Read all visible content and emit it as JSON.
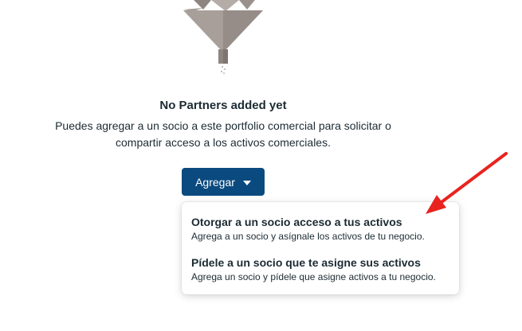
{
  "empty_state": {
    "title": "No Partners added yet",
    "description": "Puedes agregar a un socio a este portfolio comercial para solicitar o compartir acceso a los activos comerciales."
  },
  "add_button": {
    "label": "Agregar",
    "icon": "caret-down-icon",
    "color": "#0a4a7f"
  },
  "menu": {
    "items": [
      {
        "title": "Otorgar a un socio acceso a tus activos",
        "description": "Agrega a un socio y asígnale los activos de tu negocio."
      },
      {
        "title": "Pídele a un socio que te asigne sus activos",
        "description": "Agrega un socio y pídele que asigne activos a tu negocio."
      }
    ]
  },
  "annotation": {
    "icon": "red-arrow-icon",
    "color": "#e8231f"
  }
}
